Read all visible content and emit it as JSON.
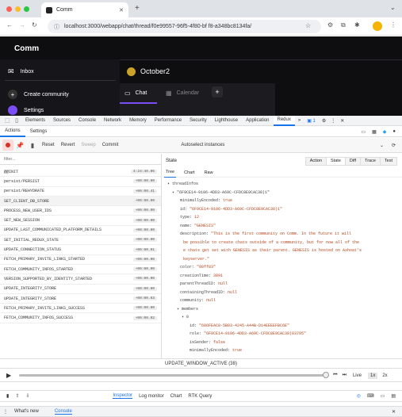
{
  "browser": {
    "tab_title": "Comm",
    "url": "localhost:3000/webapp/chat/thread/f0e99557-96f5-4f80-bf f8-a348bc8134fa/"
  },
  "app": {
    "brand": "Comm",
    "community_name": "October2",
    "nav": {
      "inbox": "Inbox",
      "create_community": "Create community",
      "settings": "Settings"
    },
    "tabs": {
      "chat": "Chat",
      "calendar": "Calendar"
    }
  },
  "devtools": {
    "tabs": [
      "Elements",
      "Sources",
      "Console",
      "Network",
      "Memory",
      "Performance",
      "Security",
      "Lighthouse",
      "Application",
      "Redux"
    ],
    "active_tab": "Redux",
    "more": "»",
    "issues": "1",
    "redux": {
      "subtabs": {
        "actions": "Actions",
        "settings": "Settings"
      },
      "controls": {
        "reset": "Reset",
        "revert": "Revert",
        "sweep": "Sweep",
        "commit": "Commit"
      },
      "autoselect": "Autoselect instances",
      "filter_placeholder": "filter...",
      "state_label": "State",
      "view_tabs": [
        "Action",
        "State",
        "Diff",
        "Trace",
        "Test"
      ],
      "format_tabs": [
        "Tree",
        "Chart",
        "Raw"
      ],
      "actions": [
        {
          "name": "@@INIT",
          "time": "4:24:49.06"
        },
        {
          "name": "persist/PERSIST",
          "time": "+00:00.00"
        },
        {
          "name": "persist/REHYDRATE",
          "time": "+00:00.41"
        },
        {
          "name": "SET_CLIENT_DB_STORE",
          "time": "+00:00.00"
        },
        {
          "name": "PROCESS_NEW_USER_IDS",
          "time": "+00:00.00"
        },
        {
          "name": "SET_NEW_SESSION",
          "time": "+00:00.00"
        },
        {
          "name": "UPDATE_LAST_COMMUNICATED_PLATFORM_DETAILS",
          "time": "+00:00.00"
        },
        {
          "name": "SET_INITIAL_REDUX_STATE",
          "time": "+00:00.00"
        },
        {
          "name": "UPDATE_CONNECTION_STATUS",
          "time": "+00:00.01"
        },
        {
          "name": "FETCH_PRIMARY_INVITE_LINKS_STARTED",
          "time": "+00:00.00"
        },
        {
          "name": "FETCH_COMMUNITY_INFOS_STARTED",
          "time": "+00:00.00"
        },
        {
          "name": "VERSION_SUPPORTED_BY_IDENTITY_STARTED",
          "time": "+00:00.00"
        },
        {
          "name": "UPDATE_INTEGRITY_STORE",
          "time": "+00:00.00"
        },
        {
          "name": "UPDATE_INTEGRITY_STORE",
          "time": "+00:00.03"
        },
        {
          "name": "FETCH_PRIMARY_INVITE_LINKS_SUCCESS",
          "time": "+00:00.00"
        },
        {
          "name": "FETCH_COMMUNITY_INFOS_SUCCESS",
          "time": "+00:00.02"
        }
      ],
      "tree": {
        "root_key": "threadInfos",
        "thread_id_key": "\"6F9CE14-9106-4DD3-A69C-CFDC8E9CAC38|1\"",
        "fields": [
          {
            "k": "minimallyEncoded",
            "v": "true"
          },
          {
            "k": "id",
            "v": "\"6F9CE14-9106-4DD3-A69C-CFDC8E9CAC38|1\""
          },
          {
            "k": "type",
            "v": "12"
          },
          {
            "k": "name",
            "v": "\"GENESIS\""
          },
          {
            "k": "description",
            "v": "\"This is the first community on Comm. In the future it will"
          },
          {
            "k": "",
            "v": "be possible to create chats outside of a community, but for now all of the"
          },
          {
            "k": "",
            "v": "e chats get set with GENESIS as their parent. GENESIS is hosted on Ashoat's"
          },
          {
            "k": "",
            "v": "keyserver.\""
          },
          {
            "k": "color",
            "v": "\"00ff83\""
          },
          {
            "k": "creationTime",
            "v": "3891"
          },
          {
            "k": "parentThreadID",
            "v": "null"
          },
          {
            "k": "containingThreadID",
            "v": "null"
          },
          {
            "k": "community",
            "v": "null"
          }
        ],
        "members_key": "members",
        "member_index": "0",
        "member_fields": [
          {
            "k": "id",
            "v": "\"686FEAC8-5B03-4245-A44B-D14EEEEFBC6E\""
          },
          {
            "k": "role",
            "v": "\"6F9CE14-9106-4DD3-A69C-CFDC8E9CAC38|83795\""
          },
          {
            "k": "isSender",
            "v": "false"
          },
          {
            "k": "minimallyEncoded",
            "v": "true"
          }
        ]
      },
      "slider": {
        "current_action": "UPDATE_WINDOW_ACTIVE (38)",
        "live": "Live",
        "speed1": "1x",
        "speed2": "2x"
      },
      "bottom_tabs": [
        "Inspector",
        "Log monitor",
        "Chart",
        "RTK Query"
      ]
    },
    "drawer": {
      "whats_new": "What's new",
      "console": "Console"
    }
  },
  "colors": {
    "accent": "#1a73e8",
    "redux_active": "#7b4df5"
  }
}
